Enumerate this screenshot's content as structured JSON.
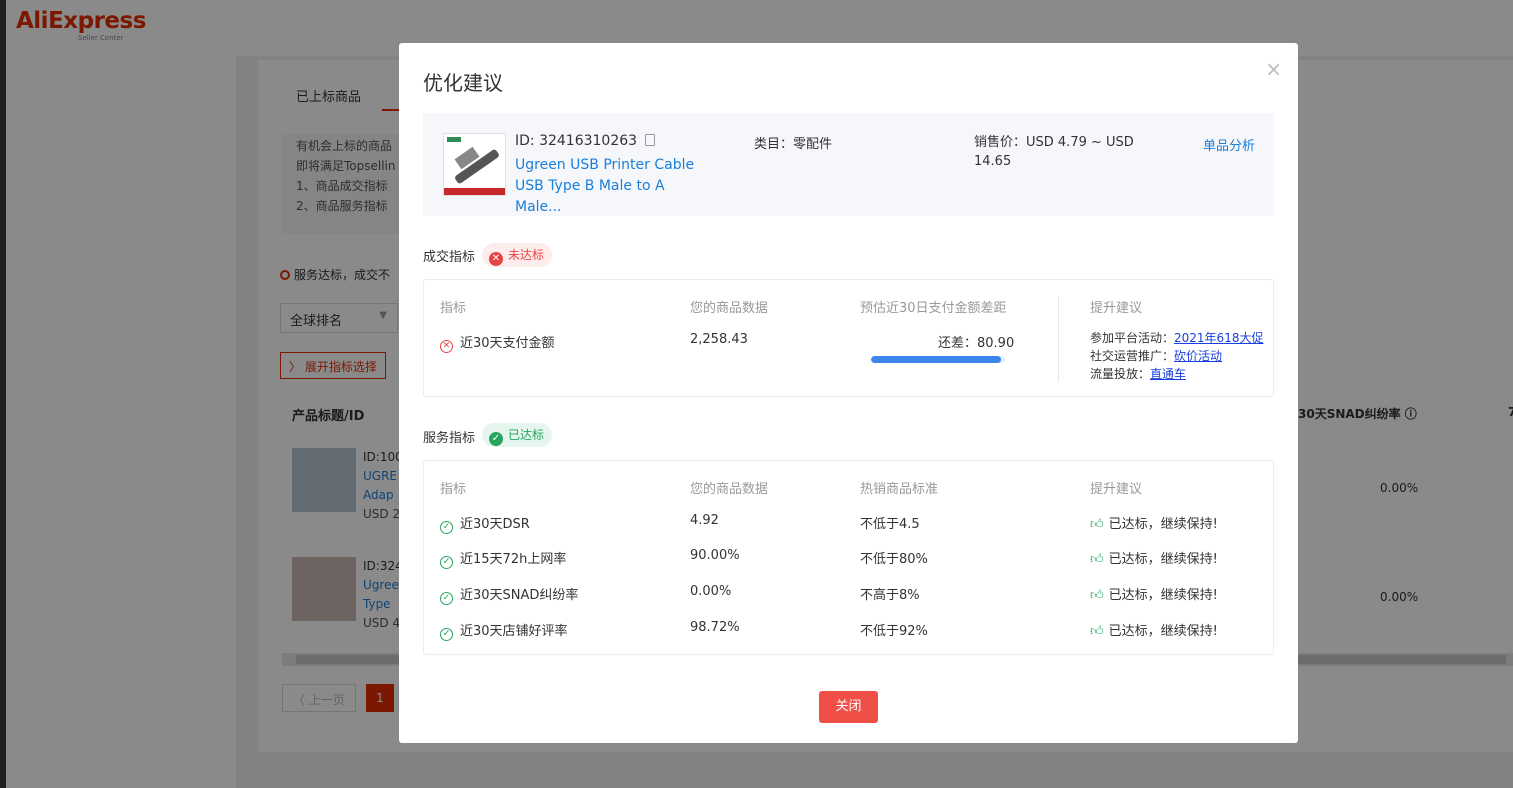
{
  "background": {
    "logo": {
      "text": "AliExpress",
      "sub": "Seller Center"
    },
    "tab_label": "已上标商品",
    "notice_lines": [
      "有机会上标的商品",
      "即将满足Topsellin",
      "1、商品成交指标",
      "2、商品服务指标"
    ],
    "status_text": "服务达标，成交不",
    "select_value": "全球排名",
    "expand_label": "展开指标选择",
    "th_product": "产品标题/ID",
    "th_snad": "30天SNAD纠纷率 ⓘ",
    "th_more": "7",
    "rows": [
      {
        "id": "ID:100",
        "title1": "UGRE",
        "title2": "Adap",
        "price": "USD 2",
        "snad": "0.00%"
      },
      {
        "id": "ID:324",
        "title1": "Ugree",
        "title2": "Type",
        "price": "USD 4",
        "snad": "0.00%"
      }
    ],
    "prev_label": "上一页",
    "page_num": "1"
  },
  "modal": {
    "title": "优化建议",
    "close_glyph": "×",
    "product": {
      "id": "ID: 32416310263",
      "name": "Ugreen USB Printer Cable USB Type B Male to A Male...",
      "category": "类目：零配件",
      "price": "销售价：USD 4.79 ~ USD 14.65",
      "analyze_link": "单品分析"
    },
    "trade": {
      "label": "成交指标",
      "badge": "未达标",
      "headers": {
        "metric": "指标",
        "data": "您的商品数据",
        "gap": "预估近30日支付金额差距",
        "advice": "提升建议"
      },
      "row": {
        "metric": "近30天支付金额",
        "value": "2,258.43",
        "gap_text": "还差：80.90",
        "progress": 0.97
      },
      "suggestions": [
        {
          "label": "参加平台活动：",
          "link": "2021年618大促"
        },
        {
          "label": "社交运营推广：",
          "link": "砍价活动"
        },
        {
          "label": "流量投放：",
          "link": "直通车"
        }
      ]
    },
    "service": {
      "label": "服务指标",
      "badge": "已达标",
      "headers": {
        "metric": "指标",
        "data": "您的商品数据",
        "standard": "热销商品标准",
        "advice": "提升建议"
      },
      "rows": [
        {
          "metric": "近30天DSR",
          "value": "4.92",
          "standard": "不低于4.5",
          "advice": "已达标，继续保持!"
        },
        {
          "metric": "近15天72h上网率",
          "value": "90.00%",
          "standard": "不低于80%",
          "advice": "已达标，继续保持!"
        },
        {
          "metric": "近30天SNAD纠纷率",
          "value": "0.00%",
          "standard": "不高于8%",
          "advice": "已达标，继续保持!"
        },
        {
          "metric": "近30天店铺好评率",
          "value": "98.72%",
          "standard": "不低于92%",
          "advice": "已达标，继续保持!"
        }
      ]
    },
    "close_button": "关闭"
  },
  "colors": {
    "accent": "#e62e04",
    "link": "#1a7fd8",
    "success": "#27a561",
    "danger": "#e54545",
    "primary_button": "#f04f48"
  }
}
